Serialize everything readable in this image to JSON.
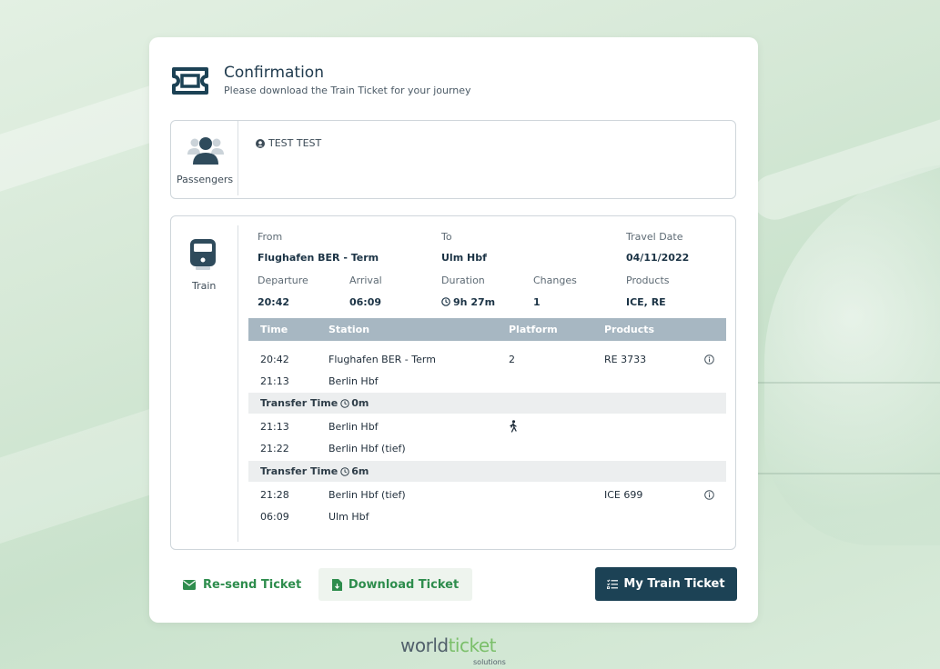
{
  "header": {
    "title": "Confirmation",
    "subtitle": "Please download the Train Ticket for your journey"
  },
  "passengers": {
    "label": "Passengers",
    "names": [
      "TEST TEST"
    ]
  },
  "journey": {
    "side_label": "Train",
    "from_label": "From",
    "from_value": "Flughafen BER - Term",
    "to_label": "To",
    "to_value": "Ulm Hbf",
    "travel_date_label": "Travel Date",
    "travel_date_value": "04/11/2022",
    "departure_label": "Departure",
    "departure_value": "20:42",
    "arrival_label": "Arrival",
    "arrival_value": "06:09",
    "duration_label": "Duration",
    "duration_value": "9h 27m",
    "changes_label": "Changes",
    "changes_value": "1",
    "products_label": "Products",
    "products_value": "ICE, RE"
  },
  "table": {
    "headers": {
      "time": "Time",
      "station": "Station",
      "platform": "Platform",
      "products": "Products"
    },
    "segments": [
      {
        "rows": [
          {
            "time": "20:42",
            "station": "Flughafen BER - Term",
            "platform": "2",
            "product": "RE 3733"
          },
          {
            "time": "21:13",
            "station": "Berlin Hbf",
            "platform": "",
            "product": ""
          }
        ]
      },
      {
        "rows": [
          {
            "time": "21:13",
            "station": "Berlin Hbf",
            "platform": "",
            "product": ""
          },
          {
            "time": "21:22",
            "station": "Berlin Hbf (tief)",
            "platform": "",
            "product": ""
          }
        ]
      },
      {
        "rows": [
          {
            "time": "21:28",
            "station": "Berlin Hbf (tief)",
            "platform": "",
            "product": "ICE 699"
          },
          {
            "time": "06:09",
            "station": "Ulm Hbf",
            "platform": "",
            "product": ""
          }
        ]
      }
    ],
    "transfers": [
      {
        "label": "Transfer Time",
        "value": "0m"
      },
      {
        "label": "Transfer Time",
        "value": "6m"
      }
    ]
  },
  "actions": {
    "resend": "Re-send Ticket",
    "download": "Download Ticket",
    "my_ticket": "My Train Ticket"
  },
  "footer": {
    "brand_part1": "world",
    "brand_part2": "ticket",
    "brand_sub": "solutions"
  },
  "colors": {
    "primary": "#1c4255",
    "accent_green": "#2e8d4d",
    "table_header": "#a7b7c2"
  },
  "icons": {
    "header": "ticket-icon",
    "passengers": "users-icon",
    "passenger_name": "user-circle-icon",
    "train": "train-icon",
    "duration": "clock-icon",
    "info": "info-icon",
    "walk": "walking-icon",
    "resend": "envelope-icon",
    "download": "file-download-icon",
    "my_ticket": "list-check-icon"
  }
}
